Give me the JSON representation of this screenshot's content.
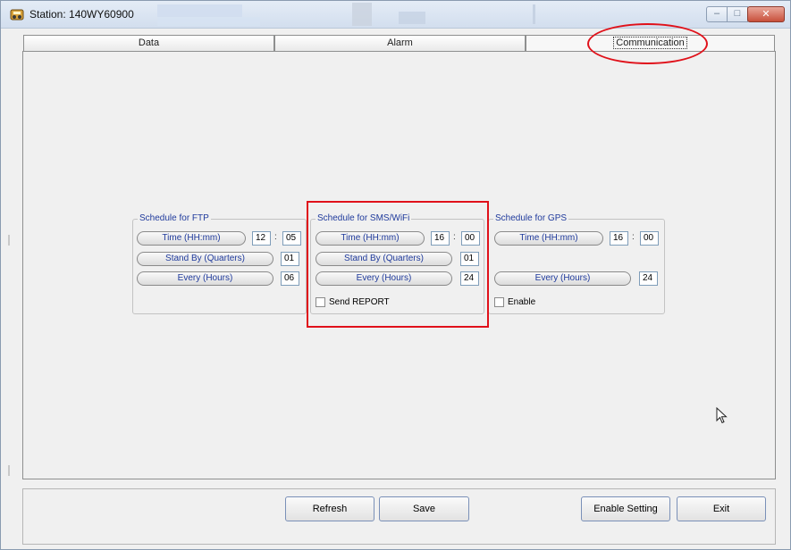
{
  "window": {
    "title": "Station: 140WY60900"
  },
  "tabs": [
    {
      "label": "Data"
    },
    {
      "label": "Alarm"
    },
    {
      "label": "Communication"
    }
  ],
  "ftp": {
    "title": "Schedule for FTP",
    "time_label": "Time (HH:mm)",
    "time_hh": "12",
    "time_mm": "05",
    "standby_label": "Stand By (Quarters)",
    "standby_value": "01",
    "every_label": "Every (Hours)",
    "every_value": "06"
  },
  "sms": {
    "title": "Schedule for SMS/WiFi",
    "time_label": "Time (HH:mm)",
    "time_hh": "16",
    "time_mm": "00",
    "standby_label": "Stand By (Quarters)",
    "standby_value": "01",
    "every_label": "Every (Hours)",
    "every_value": "24",
    "checkbox_label": "Send REPORT",
    "checked": false
  },
  "gps": {
    "title": "Schedule for GPS",
    "time_label": "Time (HH:mm)",
    "time_hh": "16",
    "time_mm": "00",
    "every_label": "Every (Hours)",
    "every_value": "24",
    "checkbox_label": "Enable",
    "checked": false
  },
  "time_separator": ":",
  "buttons": {
    "refresh": "Refresh",
    "save": "Save",
    "enable_setting": "Enable Setting",
    "exit": "Exit"
  },
  "colors": {
    "annotation": "#e0111a",
    "label_blue": "#1f3a9c"
  }
}
